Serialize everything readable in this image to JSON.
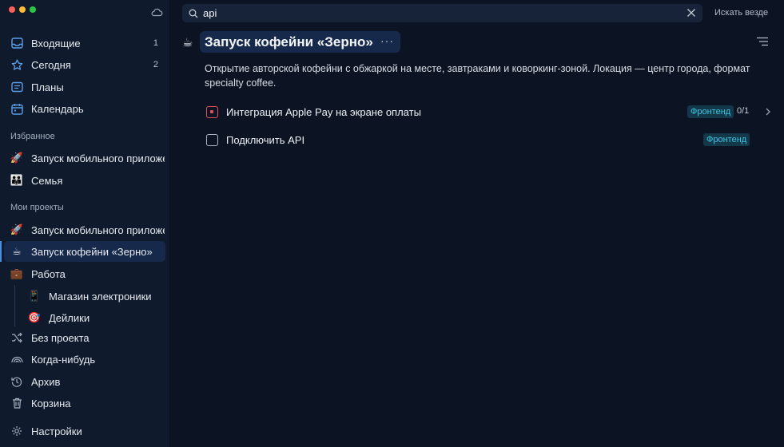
{
  "window": {
    "traffic_colors": [
      "#ff5f57",
      "#febc2e",
      "#28c840"
    ]
  },
  "sidebar": {
    "nav": [
      {
        "label": "Входящие",
        "count": "1",
        "icon": "inbox-icon"
      },
      {
        "label": "Сегодня",
        "count": "2",
        "icon": "star-icon"
      },
      {
        "label": "Планы",
        "count": "",
        "icon": "plans-icon"
      },
      {
        "label": "Календарь",
        "count": "",
        "icon": "calendar-icon"
      }
    ],
    "favorites_title": "Избранное",
    "favorites": [
      {
        "label": "Запуск мобильного приложения",
        "emoji": "🚀"
      },
      {
        "label": "Семья",
        "emoji": "👪"
      }
    ],
    "projects_title": "Мои проекты",
    "projects": [
      {
        "label": "Запуск мобильного приложения",
        "emoji": "🚀"
      },
      {
        "label": "Запуск кофейни «Зерно»",
        "emoji": "☕"
      },
      {
        "label": "Работа",
        "emoji": "💼"
      },
      {
        "label": "Магазин электроники",
        "emoji": "📱"
      },
      {
        "label": "Дейлики",
        "emoji": "🎯"
      }
    ],
    "bottom": [
      {
        "label": "Без проекта",
        "icon": "shuffle-icon"
      },
      {
        "label": "Когда-нибудь",
        "icon": "rainbow-icon"
      },
      {
        "label": "Архив",
        "icon": "history-icon"
      },
      {
        "label": "Корзина",
        "icon": "trash-icon"
      }
    ],
    "settings_label": "Настройки"
  },
  "search": {
    "value": "api",
    "search_everywhere": "Искать везде"
  },
  "project": {
    "emoji": "☕",
    "title": "Запуск кофейни «Зерно»",
    "more": "···",
    "description": "Открытие авторской кофейни с обжаркой на месте, завтраками и коворкинг-зоной. Локация — центр города, формат specialty coffee."
  },
  "tasks": [
    {
      "title": "Интеграция Apple Pay на экране оплаты",
      "tag": "Фронтенд",
      "subtasks": "0/1",
      "priority": true
    },
    {
      "title": "Подключить API",
      "tag": "Фронтенд",
      "subtasks": "",
      "priority": false
    }
  ],
  "colors": {
    "accent": "#4a8ee0",
    "tag_text": "#38c6e0",
    "priority": "#e0505a"
  }
}
